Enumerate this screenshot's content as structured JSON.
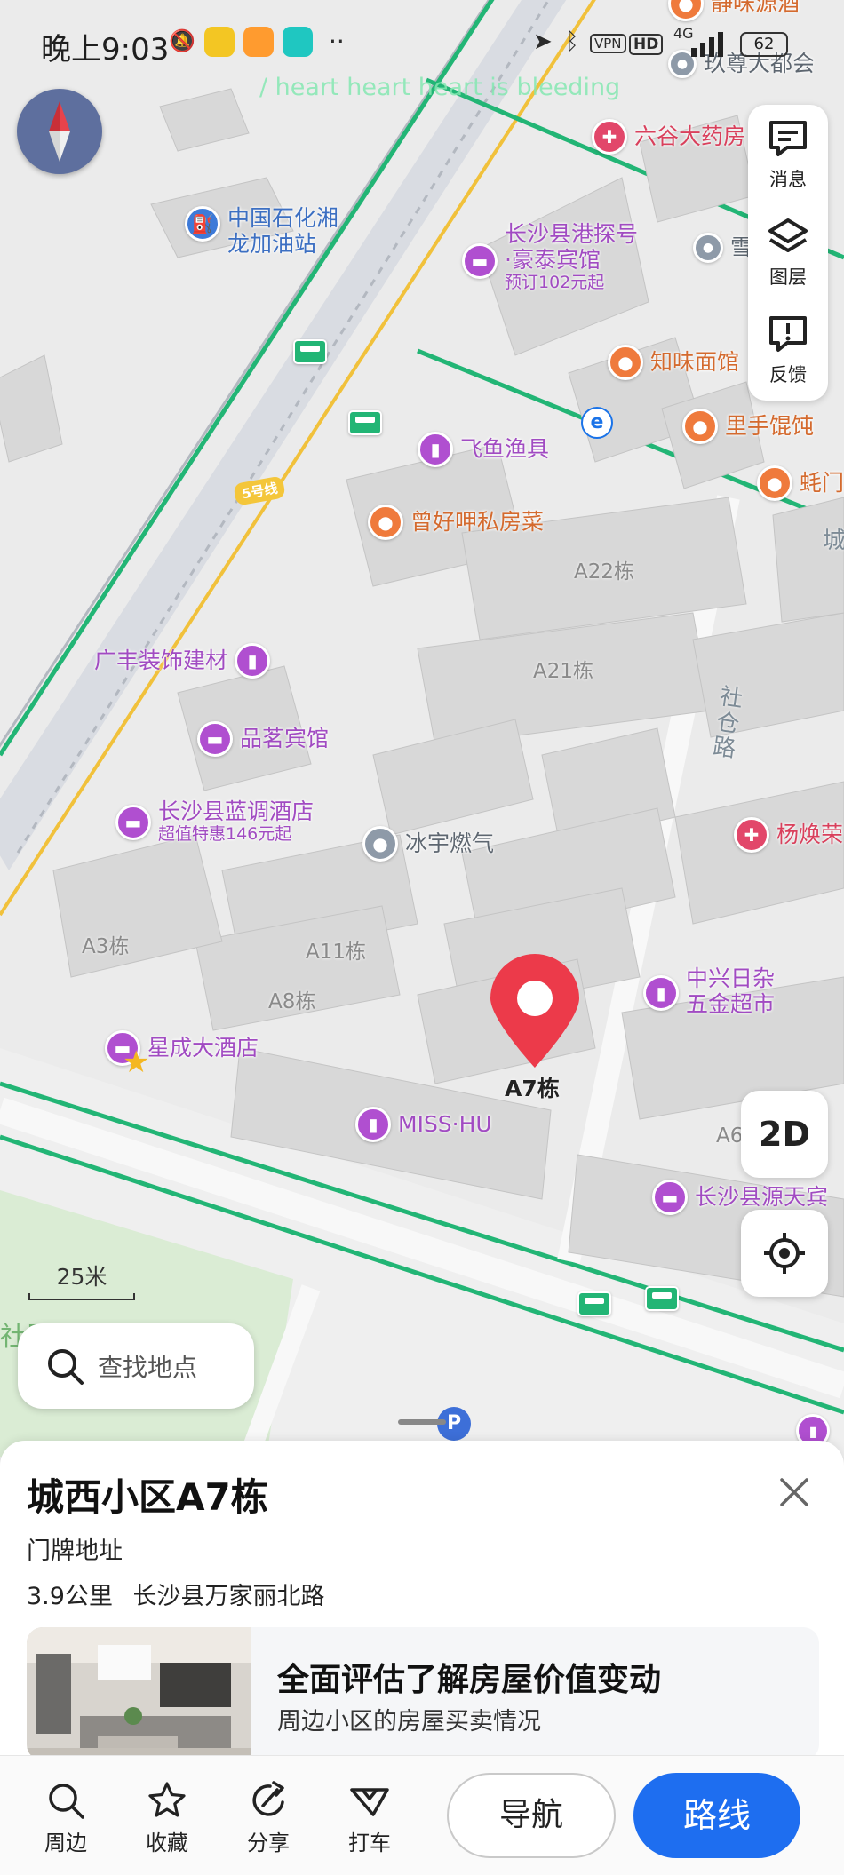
{
  "status_bar": {
    "time": "晚上9:03",
    "vpn": "VPN",
    "hd": "HD",
    "network": "4G",
    "battery": "62",
    "more": "··"
  },
  "overlay_text": "/ heart heart heart is bleeding",
  "map": {
    "pois": [
      {
        "label": "静味源酒",
        "color": "orange"
      },
      {
        "label": "玖尊大都会",
        "color": "gray"
      },
      {
        "label": "六谷大药房",
        "color": "pink"
      },
      {
        "label": "中国石化湘",
        "sub_label": "龙加油站",
        "color": "blue"
      },
      {
        "label": "长沙县港探号",
        "sub_label": "·豪泰宾馆",
        "note": "预订102元起",
        "color": "purple"
      },
      {
        "label": "雪",
        "color": "gray"
      },
      {
        "label": "知味面馆",
        "color": "orange"
      },
      {
        "label": "里手馄饨",
        "color": "orange"
      },
      {
        "label": "飞鱼渔具",
        "color": "purple"
      },
      {
        "label": "蚝门",
        "color": "orange"
      },
      {
        "label": "曾好呷私房菜",
        "color": "orange"
      },
      {
        "label": "广丰装饰建材",
        "color": "purple"
      },
      {
        "label": "品茗宾馆",
        "color": "purple"
      },
      {
        "label": "长沙县蓝调酒店",
        "note": "超值特惠146元起",
        "color": "purple"
      },
      {
        "label": "冰宇燃气",
        "color": "gray"
      },
      {
        "label": "杨焕荣",
        "color": "pink"
      },
      {
        "label": "中兴日杂",
        "sub_label": "五金超市",
        "color": "purple"
      },
      {
        "label": "星成大酒店",
        "color": "purple"
      },
      {
        "label": "MISS·HU",
        "color": "purple"
      },
      {
        "label": "长沙县源天宾",
        "color": "purple"
      }
    ],
    "buildings": [
      "A22栋",
      "A21栋",
      "A3栋",
      "A11栋",
      "A8栋",
      "A6"
    ],
    "roads": [
      "社仓路",
      "城"
    ],
    "metro_line": "5号线",
    "selected_marker_label": "A7栋",
    "partial_park_label": "社区公园",
    "parking_label": "P"
  },
  "right_tools": [
    {
      "label": "消息",
      "icon": "message-icon"
    },
    {
      "label": "图层",
      "icon": "layers-icon"
    },
    {
      "label": "反馈",
      "icon": "feedback-icon"
    }
  ],
  "view_toggle": "2D",
  "scale": "25米",
  "search": {
    "placeholder": "查找地点"
  },
  "place": {
    "title": "城西小区A7栋",
    "subtitle": "门牌地址",
    "distance": "3.9公里",
    "address": "长沙县万家丽北路"
  },
  "promo": {
    "title": "全面评估了解房屋价值变动",
    "desc": "周边小区的房屋买卖情况"
  },
  "bottom_bar": {
    "nearby": "周边",
    "favorite": "收藏",
    "share": "分享",
    "taxi": "打车",
    "navigate": "导航",
    "route": "路线"
  }
}
